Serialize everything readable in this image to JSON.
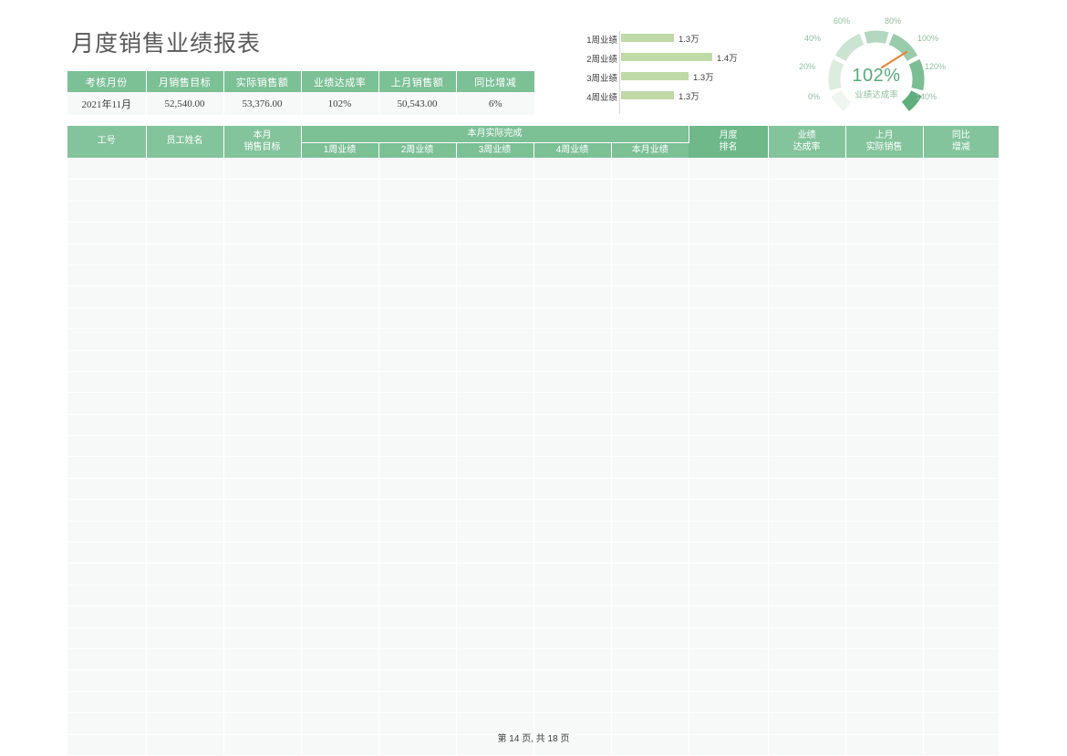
{
  "document": {
    "title": "月度销售业绩报表",
    "footer": "第 14 页, 共 18 页"
  },
  "summary_table": {
    "headers": [
      "考核月份",
      "月销售目标",
      "实际销售额",
      "业绩达成率",
      "上月销售额",
      "同比增减"
    ],
    "rows": [
      [
        "2021年11月",
        "52,540.00",
        "53,376.00",
        "102%",
        "50,543.00",
        "6%"
      ]
    ]
  },
  "bar_chart": {
    "categories": [
      "1周业绩",
      "2周业绩",
      "3周业绩",
      "4周业绩"
    ],
    "labels": [
      "1.3万",
      "1.4万",
      "1.3万",
      "1.3万"
    ]
  },
  "gauge": {
    "value_label": "102%",
    "caption": "业绩达成率",
    "ticks": [
      "0%",
      "20%",
      "40%",
      "60%",
      "80%",
      "100%",
      "120%",
      "140%"
    ]
  },
  "main_table": {
    "group_header": "本月实际完成",
    "headers": {
      "employee_id": "工号",
      "employee_name": "员工姓名",
      "month_target_line1": "本月",
      "month_target_line2": "销售目标",
      "week1": "1周业绩",
      "week2": "2周业绩",
      "week3": "3周业绩",
      "week4": "4周业绩",
      "month_total": "本月业绩",
      "rank_line1": "月度",
      "rank_line2": "排名",
      "rate_line1": "业绩",
      "rate_line2": "达成率",
      "last_month_line1": "上月",
      "last_month_line2": "实际销售",
      "yoy_line1": "同比",
      "yoy_line2": "增减"
    },
    "row_count": 28,
    "rows": []
  },
  "chart_data": [
    {
      "type": "bar",
      "orientation": "horizontal",
      "title": "",
      "categories": [
        "1周业绩",
        "2周业绩",
        "3周业绩",
        "4周业绩"
      ],
      "values": [
        1.3,
        1.4,
        1.3,
        1.3
      ],
      "data_labels": [
        "1.3万",
        "1.4万",
        "1.3万",
        "1.3万"
      ],
      "unit": "万",
      "xlabel": "",
      "ylabel": "",
      "grid": false,
      "legend": "none",
      "bar_color": "#bfd9a7"
    },
    {
      "type": "gauge",
      "title": "业绩达成率",
      "value": 102,
      "value_label": "102%",
      "min": 0,
      "max": 140,
      "tick_values": [
        0,
        20,
        40,
        60,
        80,
        100,
        120,
        140
      ],
      "tick_labels": [
        "0%",
        "20%",
        "40%",
        "60%",
        "80%",
        "100%",
        "120%",
        "140%"
      ],
      "needle_color": "#e8833a",
      "arc_colors": [
        "#eef6ef",
        "#dcecdf",
        "#cbe3d1",
        "#b4d7bf",
        "#9acbab",
        "#7cbd93",
        "#5fae7e"
      ]
    }
  ],
  "colors": {
    "header_green": "#7cc096",
    "rank_header_green": "#6eb88a",
    "cell_gray": "#f7f8f8",
    "bar_green": "#bfd9a7",
    "gauge_text": "#5aa87c",
    "gauge_tick": "#8fbf9f",
    "needle_orange": "#e8833a",
    "title_gray": "#595959"
  }
}
